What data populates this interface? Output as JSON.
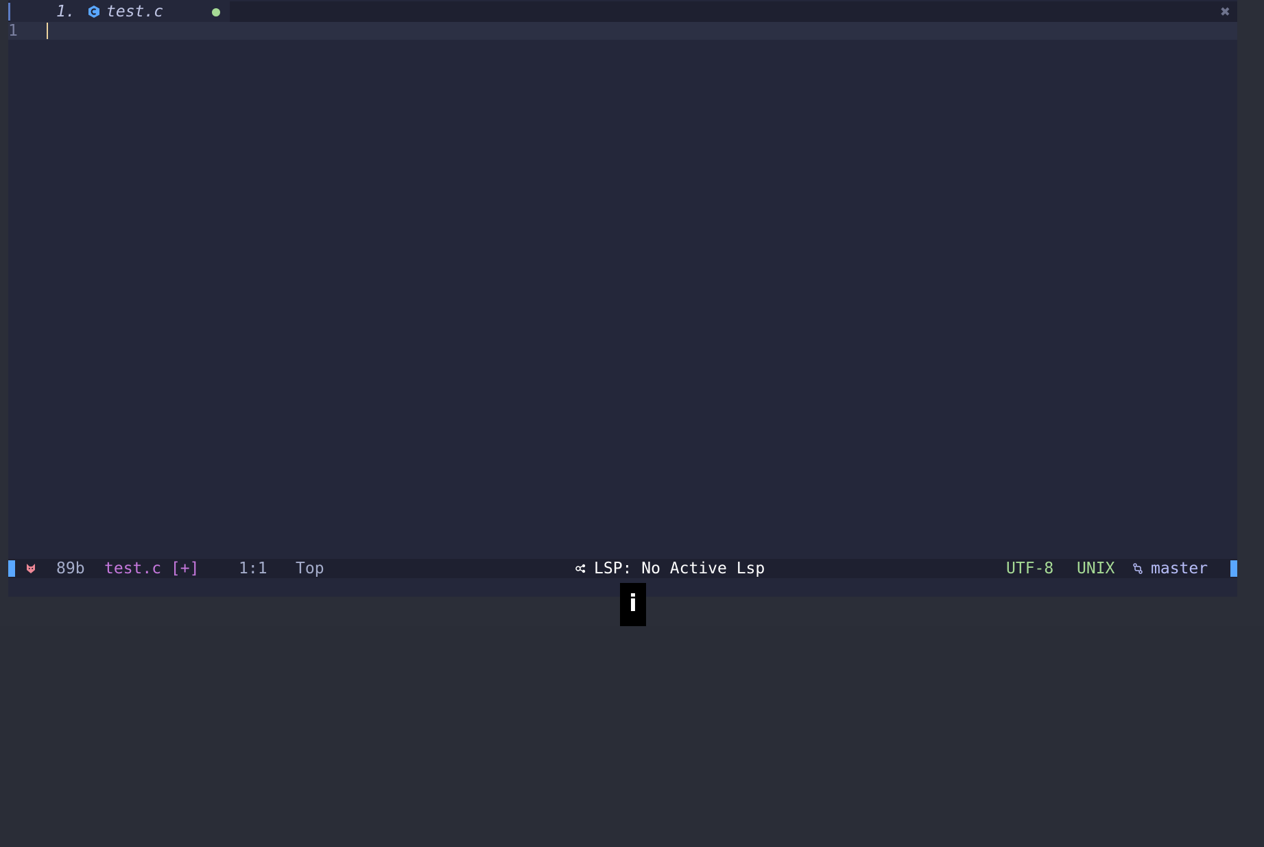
{
  "tabline": {
    "tab": {
      "number": "1.",
      "filename": "test.c",
      "icon": "c-language-icon",
      "modified": true
    },
    "close_icon": "✖"
  },
  "editor": {
    "line_numbers": [
      "1"
    ]
  },
  "statusline": {
    "file_size": "89b",
    "file_name": "test.c [+]",
    "position": "1:1",
    "scroll": "Top",
    "lsp_status": "LSP: No Active Lsp",
    "encoding": "UTF-8",
    "file_format": "UNIX",
    "branch": "master"
  },
  "overlay": {
    "info_badge": "i"
  },
  "colors": {
    "background": "#24273a",
    "tabline": "#1e2030",
    "mode_accent": "#5aa7ff",
    "modified_dot": "#a6da95",
    "filename_purple": "#c678dd",
    "encoding_green": "#a6da95",
    "cursor_yellow": "#eed49f"
  }
}
